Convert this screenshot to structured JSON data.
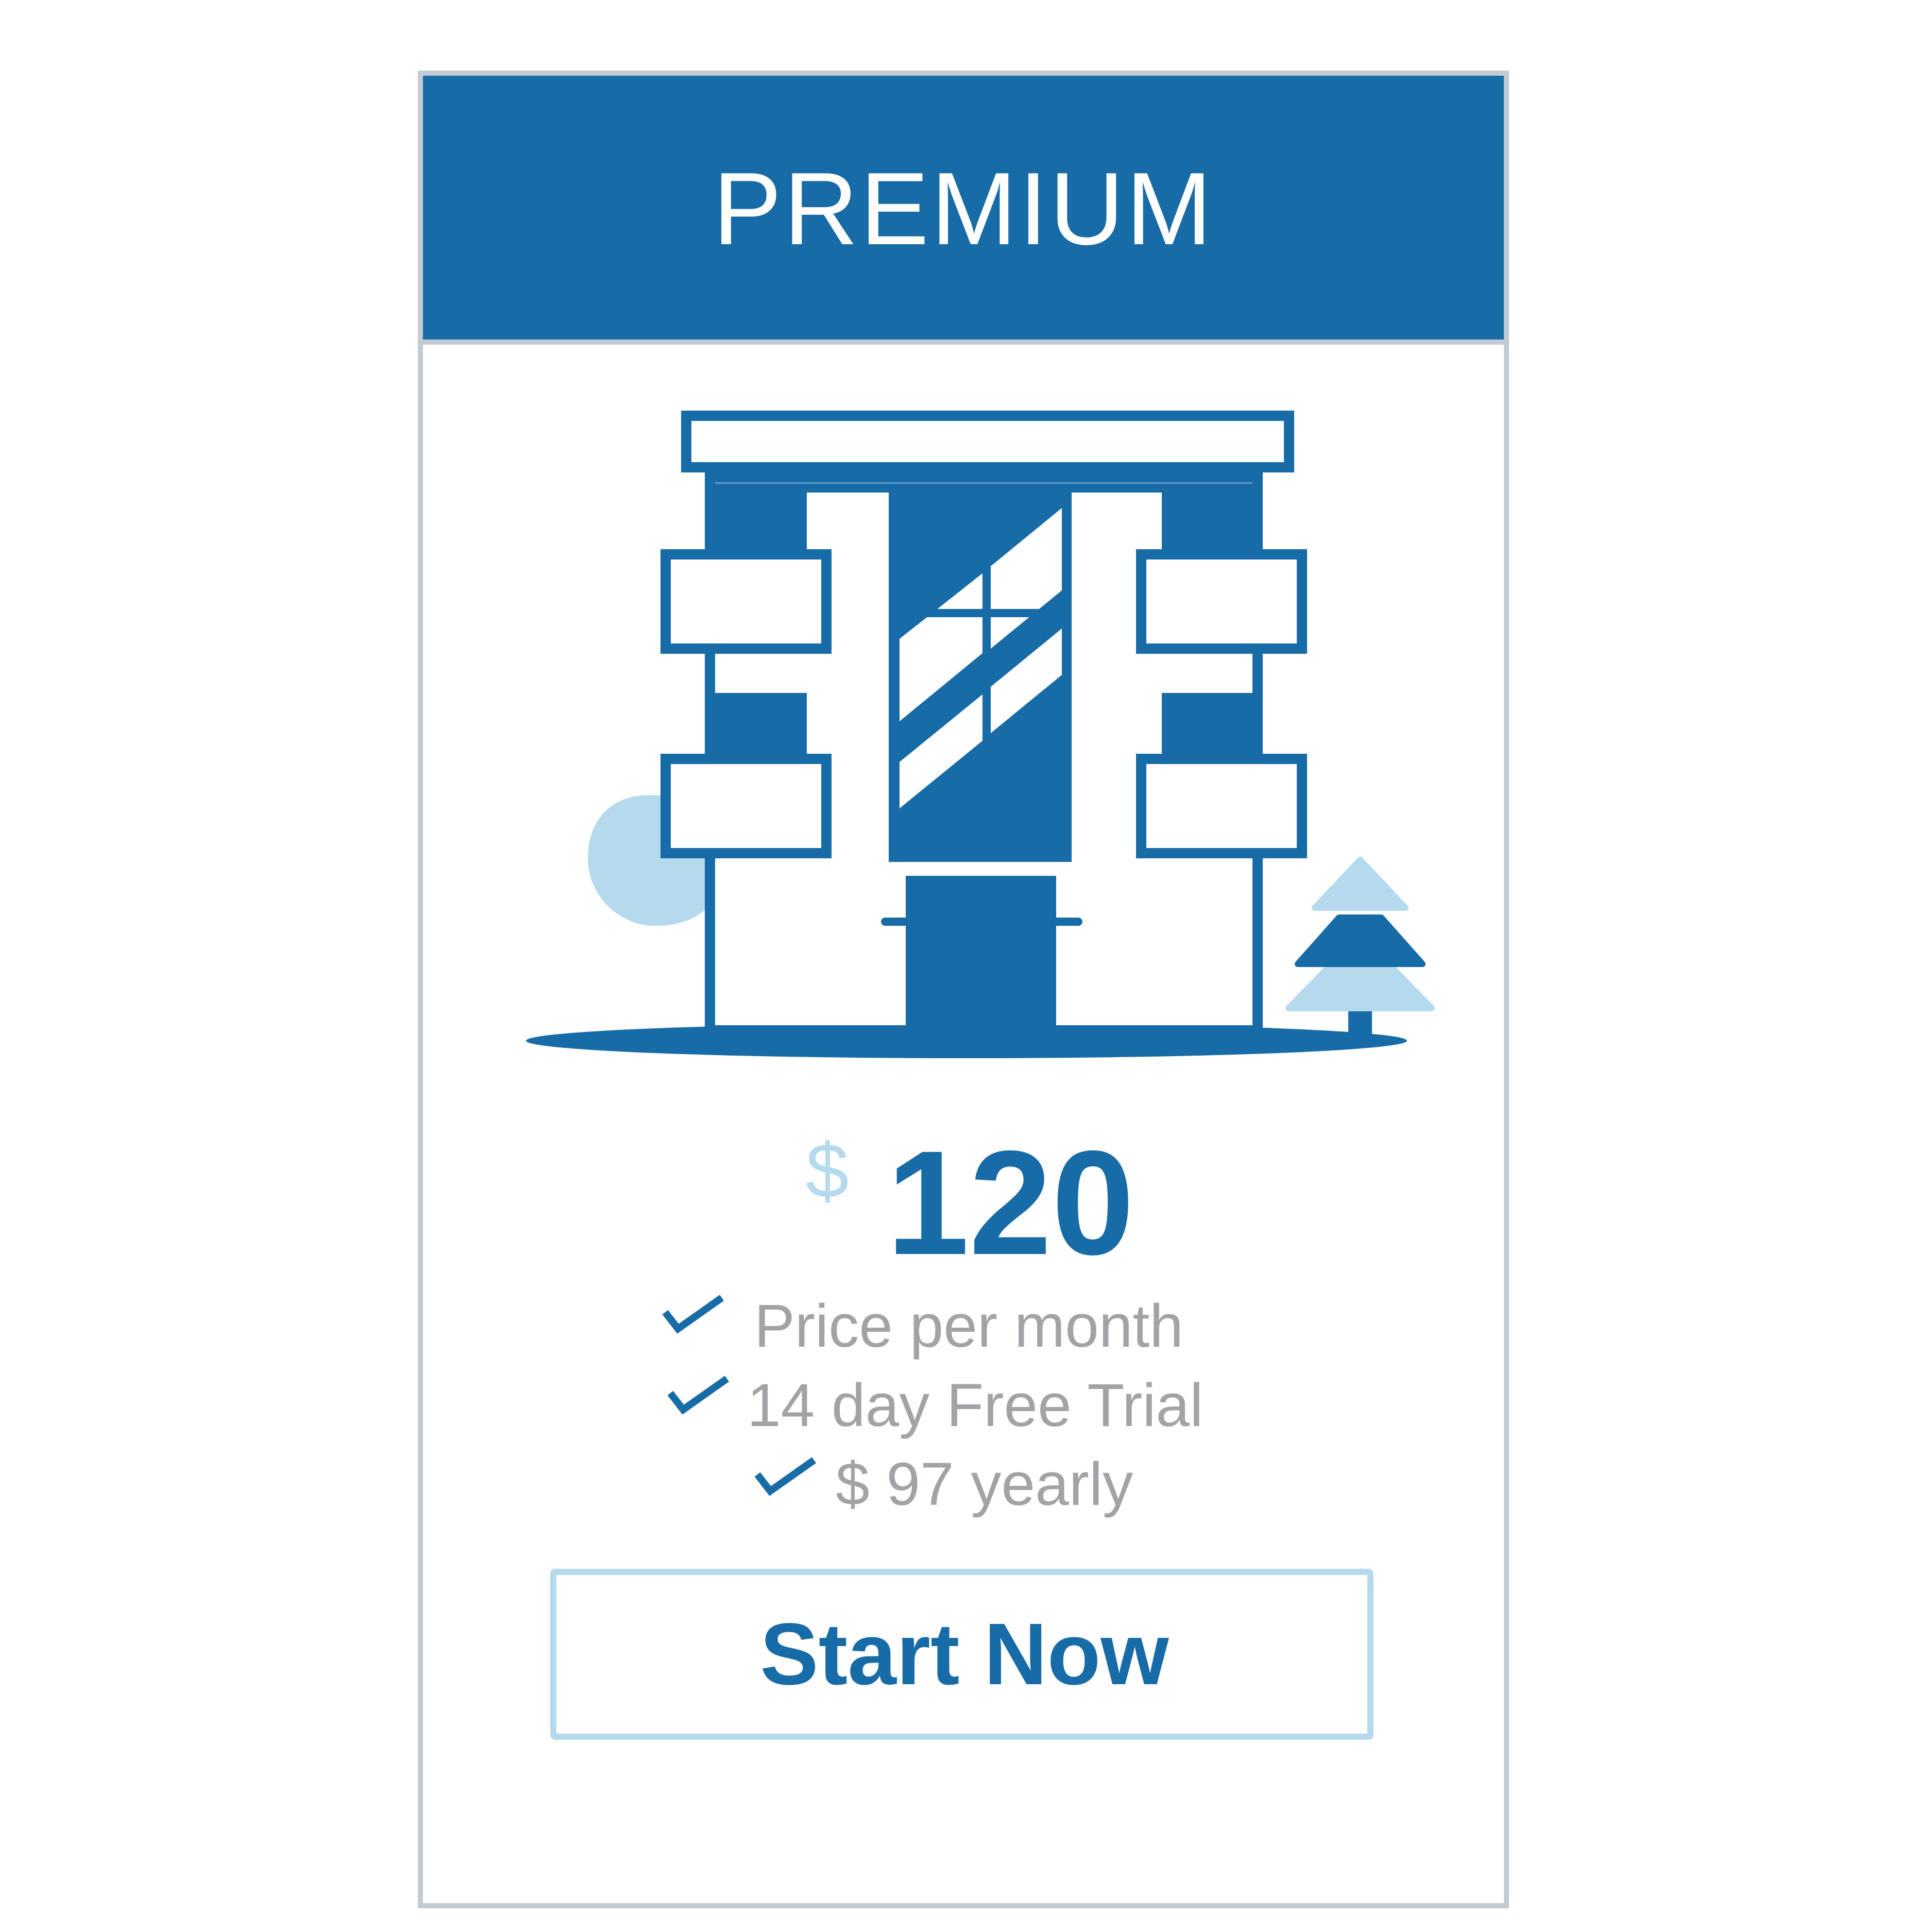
{
  "plan": {
    "name": "PREMIUM",
    "illustration": "building-icon"
  },
  "price": {
    "currency": "$",
    "amount": "120"
  },
  "features": [
    {
      "icon": "check-icon",
      "text": "Price per month"
    },
    {
      "icon": "check-icon",
      "text": "14 day Free Trial"
    },
    {
      "icon": "check-icon",
      "text": "$ 97 yearly"
    }
  ],
  "cta": {
    "label": "Start Now"
  },
  "colors": {
    "brand_blue": "#176ba7",
    "light_blue": "#b5daee",
    "border_gray": "#c2cad2",
    "text_gray": "#a2a3a6"
  }
}
